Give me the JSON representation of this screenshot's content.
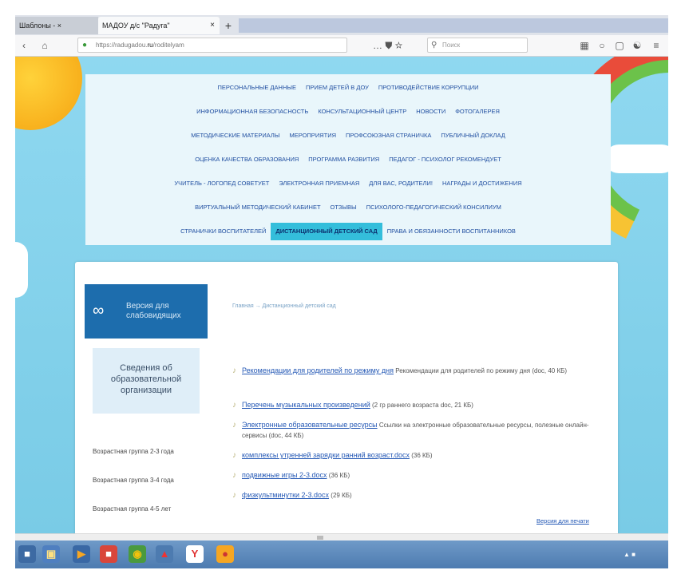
{
  "browser": {
    "tabs": [
      {
        "label": "Шаблоны - ×"
      },
      {
        "label": "МАДОУ д/с \"Радуга\""
      }
    ],
    "active_tab_close": "×",
    "new_tab": "+",
    "url_prefix": "https://radugadou.",
    "url_domain": "ru",
    "url_suffix": "/roditelyam",
    "search_placeholder": "Поиск",
    "menu_dots": "… ⛊ ☆"
  },
  "menu": {
    "rows": [
      [
        "Персональные данные",
        "Прием детей в ДОУ",
        "Противодействие коррупции"
      ],
      [
        "Информационная безопасность",
        "Консультационный центр",
        "Новости",
        "Фотогалерея"
      ],
      [
        "Методические материалы",
        "Мероприятия",
        "Профсоюзная страничка",
        "Публичный доклад"
      ],
      [
        "Оценка качества образования",
        "Программа развития",
        "Педагог - психолог рекомендует"
      ],
      [
        "Учитель - логопед советует",
        "Электронная приемная",
        "Для вас, родители!",
        "Награды и достижения"
      ],
      [
        "Виртуальный методический кабинет",
        "Отзывы",
        "Психолого-педагогический консилиум"
      ],
      [
        "Странички воспитателей",
        "Дистанционный детский сад",
        "Права и обязанности воспитанников"
      ]
    ],
    "active": "Дистанционный детский сад"
  },
  "sidebar": {
    "vision_label": "Версия для слабовидящих",
    "info_label": "Сведения об образовательной организации",
    "groups": [
      "Возрастная группа 2-3 года",
      "Возрастная группа 3-4 года",
      "Возрастная группа 4-5 лет"
    ]
  },
  "content": {
    "breadcrumb": "Главная → Дистанционный детский сад",
    "documents": [
      {
        "link": "Рекомендации для родителей по режиму дня",
        "desc": "Рекомендации для родителей по режиму дня (doc, 40 КБ)"
      },
      {
        "link": "Перечень музыкальных произведений",
        "desc": "(2 гр раннего возраста doc, 21 КБ)"
      },
      {
        "link": "Электронные образовательные ресурсы",
        "desc": "Ссылки на электронные образовательные ресурсы, полезные онлайн-сервисы (doc, 44 КБ)"
      },
      {
        "link": "комплексы утренней зарядки ранний возраст.docx",
        "desc": "(36 КБ)"
      },
      {
        "link": "подвижные игры 2-3.docx",
        "desc": "(36 КБ)"
      },
      {
        "link": "физкультминутки 2-3.docx",
        "desc": "(29 КБ)"
      }
    ],
    "more_link": "Версия для печати"
  },
  "colors": {
    "accent": "#34bedb",
    "link": "#2458b5",
    "vision_bg": "#1d6dad",
    "page_bg": "#7ed0ea"
  },
  "icons": [
    "home-icon",
    "lock-icon",
    "search-icon",
    "glasses-icon",
    "document-icon"
  ]
}
